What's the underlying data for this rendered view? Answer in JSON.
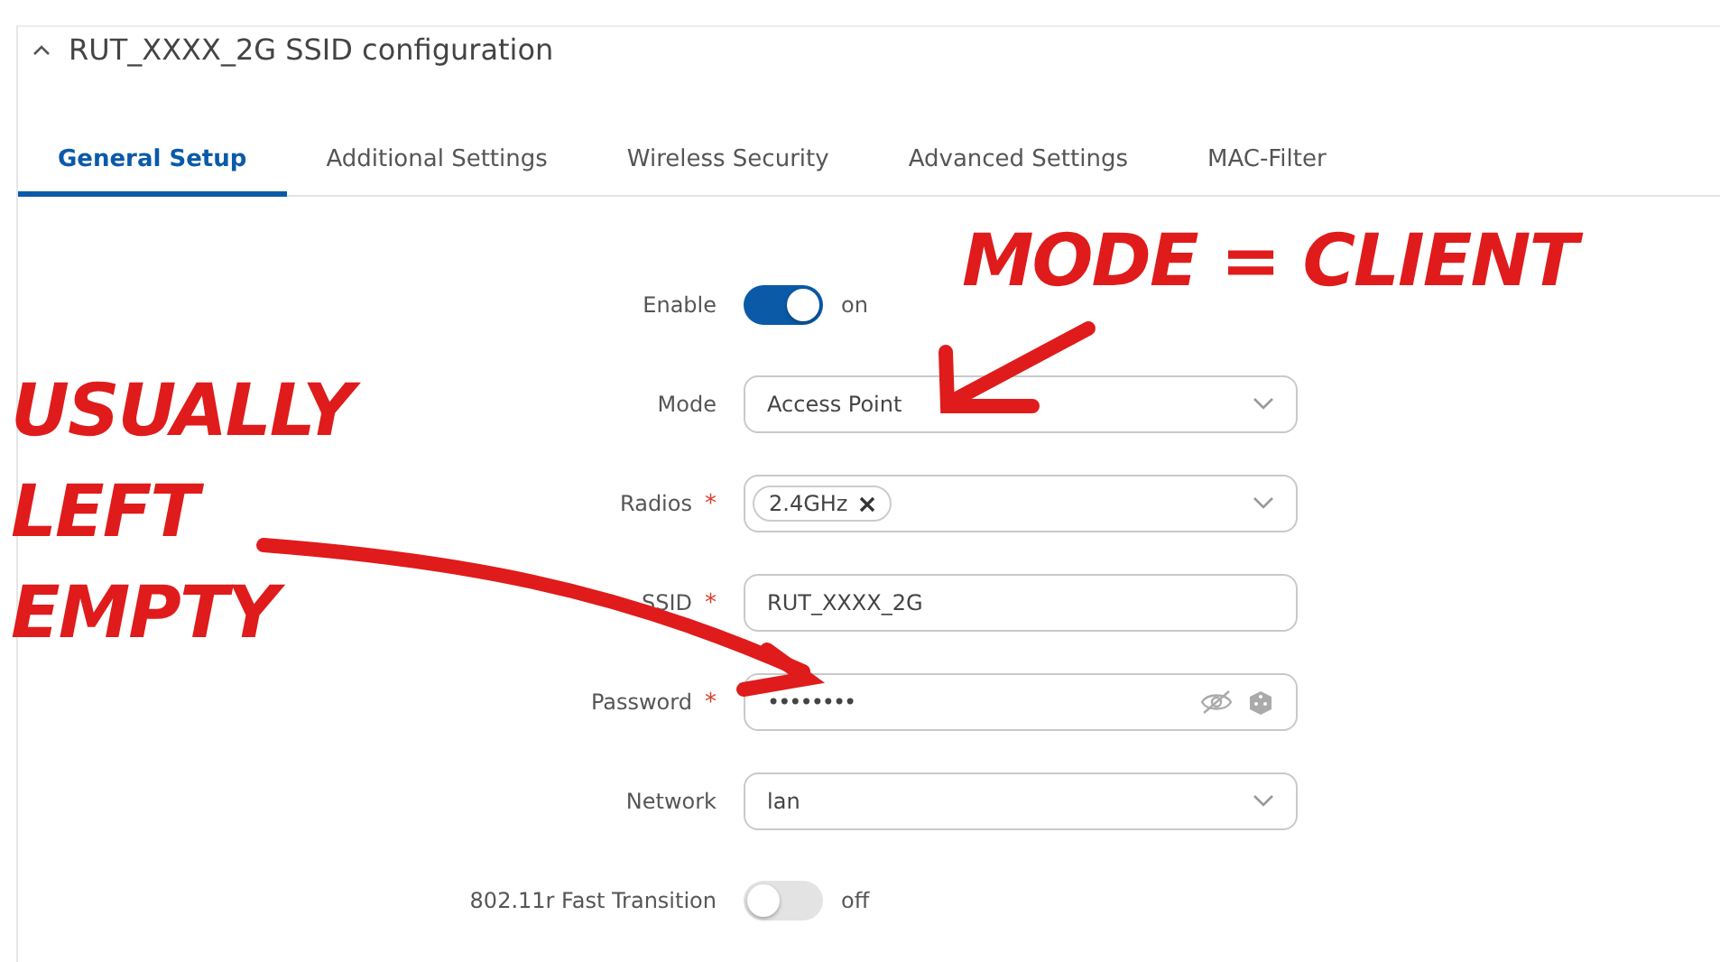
{
  "section": {
    "title": "RUT_XXXX_2G SSID configuration",
    "expanded": true
  },
  "tabs": [
    {
      "label": "General Setup",
      "selected": true
    },
    {
      "label": "Additional Settings",
      "selected": false
    },
    {
      "label": "Wireless Security",
      "selected": false
    },
    {
      "label": "Advanced Settings",
      "selected": false
    },
    {
      "label": "MAC-Filter",
      "selected": false
    }
  ],
  "fields": [
    {
      "kind": "toggle",
      "label": "Enable",
      "on": true,
      "state_text": "on"
    },
    {
      "kind": "select",
      "label": "Mode",
      "value": "Access Point"
    },
    {
      "kind": "tags",
      "label": "Radios",
      "required_mark": "*",
      "tags": [
        "2.4GHz"
      ]
    },
    {
      "kind": "text",
      "label": "SSID",
      "required_mark": "*",
      "value": "RUT_XXXX_2G"
    },
    {
      "kind": "password",
      "label": "Password",
      "required_mark": "*",
      "value": "••••••••"
    },
    {
      "kind": "select",
      "label": "Network",
      "value": "lan"
    },
    {
      "kind": "toggle",
      "label": "802.11r Fast Transition",
      "on": false,
      "state_text": "off"
    }
  ],
  "annotations": [
    {
      "lines": [
        "MODE = CLIENT"
      ]
    },
    {
      "lines": [
        "USUALLY",
        "LEFT",
        "EMPTY"
      ]
    }
  ]
}
